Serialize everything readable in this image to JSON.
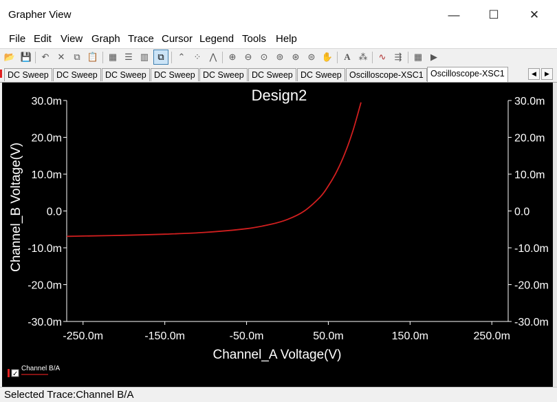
{
  "window": {
    "title": "Grapher View",
    "minimize_glyph": "—",
    "maximize_glyph": "☐",
    "close_glyph": "✕"
  },
  "menu": [
    "File",
    "Edit",
    "View",
    "Graph",
    "Trace",
    "Cursor",
    "Legend",
    "Tools",
    "Help"
  ],
  "toolbar_icons": [
    "open-folder-icon",
    "save-icon",
    "undo-icon",
    "delete-icon",
    "copy-icon",
    "paste-icon",
    "grid-icon",
    "list-icon",
    "bars-icon",
    "overlay-traces-icon",
    "line-trace-icon",
    "scatter-trace-icon",
    "line-marker-trace-icon",
    "zoom-in-icon",
    "zoom-out-icon",
    "zoom-fit-icon",
    "zoom-x-icon",
    "zoom-y-icon",
    "zoom-area-icon",
    "pan-hand-icon",
    "text-icon",
    "signal-icon",
    "waveform-icon",
    "export-icon",
    "grid-table-icon",
    "play-icon"
  ],
  "tabs": [
    "DC Sweep",
    "DC Sweep",
    "DC Sweep",
    "DC Sweep",
    "DC Sweep",
    "DC Sweep",
    "DC Sweep",
    "Oscilloscope-XSC1",
    "Oscilloscope-XSC1"
  ],
  "active_tab_index": 8,
  "tab_nav": {
    "left": "◀",
    "right": "▶"
  },
  "graph": {
    "background": "#000000",
    "axis_color": "#ffffff",
    "trace_color": "#d21f1f"
  },
  "chart_data": {
    "type": "line",
    "title": "Design2",
    "xlabel": "Channel_A Voltage(V)",
    "ylabel": "Channel_B Voltage(V)",
    "xlim": [
      -0.27,
      0.27
    ],
    "ylim": [
      -0.03,
      0.03
    ],
    "x_ticks": [
      -0.25,
      -0.15,
      -0.05,
      0.05,
      0.15,
      0.25
    ],
    "x_tick_labels": [
      "-250.0m",
      "-150.0m",
      "-50.0m",
      "50.0m",
      "150.0m",
      "250.0m"
    ],
    "y_ticks": [
      0.03,
      0.02,
      0.01,
      0,
      -0.01,
      -0.02,
      -0.03
    ],
    "y_tick_labels": [
      "30.0m",
      "20.0m",
      "10.0m",
      "0.0",
      "-10.0m",
      "-20.0m",
      "-30.0m"
    ],
    "grid": false,
    "legend": "bottom-left",
    "series": [
      {
        "name": "Channel B/A",
        "x": [
          -0.27,
          -0.25,
          -0.2,
          -0.15,
          -0.1,
          -0.05,
          -0.02,
          0,
          0.02,
          0.04,
          0.05,
          0.06,
          0.07,
          0.08,
          0.09
        ],
        "y": [
          -0.0069,
          -0.0068,
          -0.0066,
          -0.0063,
          -0.0058,
          -0.0048,
          -0.0036,
          -0.0023,
          -0.0001,
          0.0038,
          0.0068,
          0.0106,
          0.0155,
          0.0217,
          0.0295
        ]
      }
    ]
  },
  "legend_entry": {
    "label": "Channel B/A",
    "checked": true
  },
  "status": {
    "text": "Selected Trace:Channel B/A"
  }
}
